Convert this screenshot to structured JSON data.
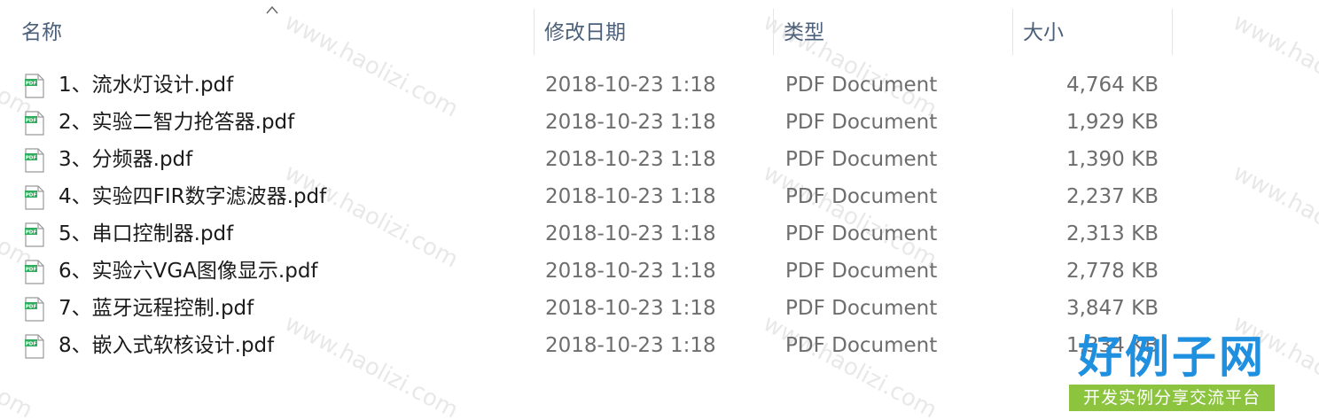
{
  "columns": {
    "name": "名称",
    "date": "修改日期",
    "type": "类型",
    "size": "大小"
  },
  "files": [
    {
      "name": "1、流水灯设计.pdf",
      "date": "2018-10-23 1:18",
      "type": "PDF Document",
      "size": "4,764 KB",
      "icon": "pdf-file-icon"
    },
    {
      "name": "2、实验二智力抢答器.pdf",
      "date": "2018-10-23 1:18",
      "type": "PDF Document",
      "size": "1,929 KB",
      "icon": "pdf-file-icon"
    },
    {
      "name": "3、分频器.pdf",
      "date": "2018-10-23 1:18",
      "type": "PDF Document",
      "size": "1,390 KB",
      "icon": "pdf-file-icon"
    },
    {
      "name": "4、实验四FIR数字滤波器.pdf",
      "date": "2018-10-23 1:18",
      "type": "PDF Document",
      "size": "2,237 KB",
      "icon": "pdf-file-icon"
    },
    {
      "name": "5、串口控制器.pdf",
      "date": "2018-10-23 1:18",
      "type": "PDF Document",
      "size": "2,313 KB",
      "icon": "pdf-file-icon"
    },
    {
      "name": "6、实验六VGA图像显示.pdf",
      "date": "2018-10-23 1:18",
      "type": "PDF Document",
      "size": "2,778 KB",
      "icon": "pdf-file-icon"
    },
    {
      "name": "7、蓝牙远程控制.pdf",
      "date": "2018-10-23 1:18",
      "type": "PDF Document",
      "size": "3,847 KB",
      "icon": "pdf-file-icon"
    },
    {
      "name": "8、嵌入式软核设计.pdf",
      "date": "2018-10-23 1:18",
      "type": "PDF Document",
      "size": "1,334 KB",
      "icon": "pdf-file-icon"
    }
  ],
  "watermark": {
    "text": "www.haolizi.com",
    "logo_main": "好例子网",
    "logo_sub": "开发实例分享交流平台"
  },
  "colors": {
    "header_text": "#4c607a",
    "name_text": "#1b1b1b",
    "detail_text": "#6d6d6d",
    "pdf_badge": "#2eae5c",
    "logo_blue": "#1f8fe0",
    "logo_green": "#8cc43f"
  }
}
